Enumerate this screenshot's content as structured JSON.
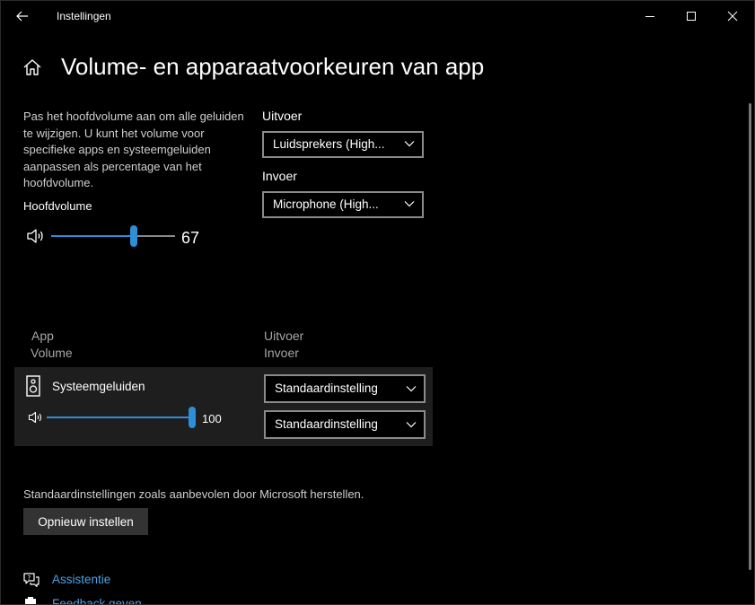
{
  "titlebar": {
    "app_title": "Instellingen",
    "icons": [
      "back-arrow-icon",
      "minimize-icon",
      "maximize-icon",
      "close-icon"
    ]
  },
  "header": {
    "title": "Volume- en apparaatvoorkeuren van app",
    "icon": "home-icon"
  },
  "master": {
    "description": "Pas het hoofdvolume aan om alle geluiden te wijzigen. U kunt het volume voor specifieke apps en systeemgeluiden aanpassen als percentage van het hoofdvolume.",
    "label": "Hoofdvolume",
    "value": 67,
    "value_text": "67"
  },
  "devices": {
    "output_label": "Uitvoer",
    "output_value": "Luidsprekers (High...",
    "input_label": "Invoer",
    "input_value": "Microphone (High..."
  },
  "columns": {
    "app": "App",
    "volume": "Volume",
    "output": "Uitvoer",
    "input": "Invoer"
  },
  "apps": [
    {
      "name": "Systeemgeluiden",
      "icon": "speaker-device-icon",
      "volume": 100,
      "volume_text": "100",
      "output": "Standaardinstelling",
      "input": "Standaardinstelling"
    }
  ],
  "reset": {
    "text": "Standaardinstellingen zoals aanbevolen door Microsoft herstellen.",
    "button_label": "Opnieuw instellen"
  },
  "links": {
    "help": "Assistentie",
    "feedback": "Feedback geven"
  },
  "colors": {
    "accent": "#2d8fd5",
    "link": "#4aa3e8",
    "background": "#000000",
    "row_background": "#1e1e1e"
  }
}
